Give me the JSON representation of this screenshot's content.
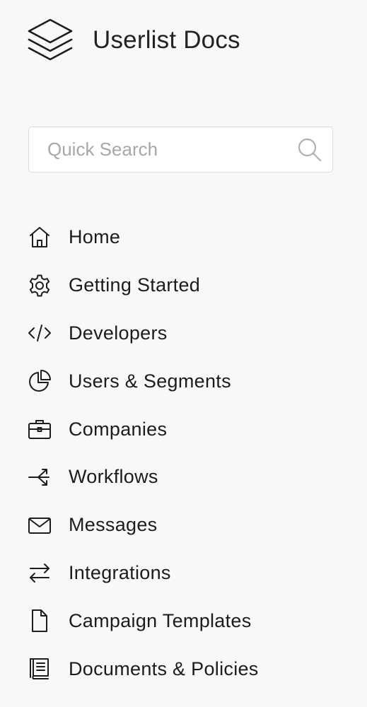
{
  "app": {
    "title": "Userlist Docs"
  },
  "search": {
    "placeholder": "Quick Search",
    "value": ""
  },
  "nav": {
    "items": [
      {
        "label": "Home",
        "icon": "home-icon"
      },
      {
        "label": "Getting Started",
        "icon": "gear-icon"
      },
      {
        "label": "Developers",
        "icon": "code-icon"
      },
      {
        "label": "Users & Segments",
        "icon": "pie-chart-icon"
      },
      {
        "label": "Companies",
        "icon": "briefcase-icon"
      },
      {
        "label": "Workflows",
        "icon": "workflow-icon"
      },
      {
        "label": "Messages",
        "icon": "envelope-icon"
      },
      {
        "label": "Integrations",
        "icon": "arrows-exchange-icon"
      },
      {
        "label": "Campaign Templates",
        "icon": "file-icon"
      },
      {
        "label": "Documents & Policies",
        "icon": "book-icon"
      }
    ]
  },
  "colors": {
    "background": "#f8f8f8",
    "text": "#1c1c1c",
    "placeholder": "#a8a8a8",
    "search_border": "#dcdcdc"
  }
}
